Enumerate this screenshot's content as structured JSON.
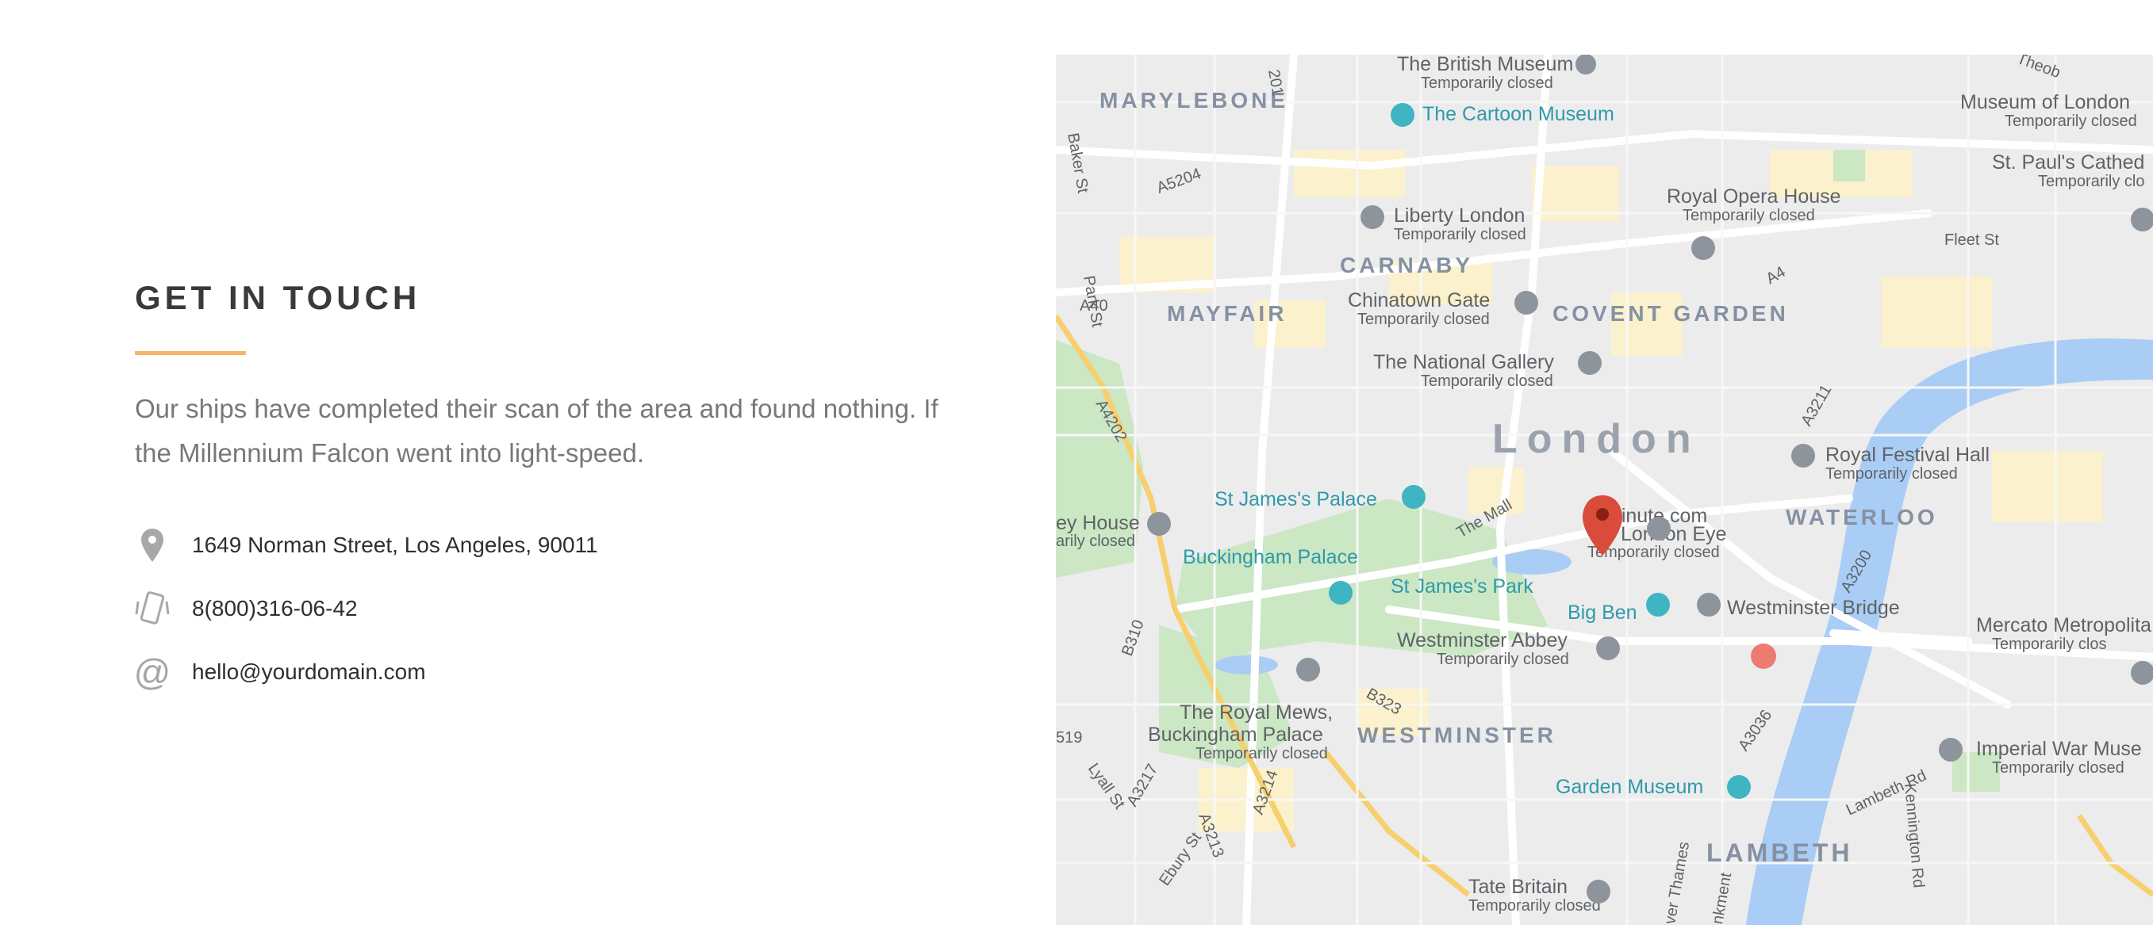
{
  "contact": {
    "heading": "GET IN TOUCH",
    "intro": "Our ships have completed their scan of the area and found nothing. If the Millennium Falcon went into light-speed.",
    "items": [
      {
        "icon": "location-pin-icon",
        "text": "1649 Norman Street, Los Angeles, 90011"
      },
      {
        "icon": "phone-icon",
        "text": "8(800)316-06-42"
      },
      {
        "icon": "at-sign-icon",
        "text": "hello@yourdomain.com"
      }
    ],
    "accent_color": "#f5b66b"
  },
  "map": {
    "city": "London",
    "districts": [
      "MARYLEBONE",
      "CARNABY",
      "MAYFAIR",
      "COVENT GARDEN",
      "WATERLOO",
      "WESTMINSTER",
      "LAMBETH"
    ],
    "pois": [
      {
        "name": "The British Museum",
        "note": "Temporarily closed"
      },
      {
        "name": "The Cartoon Museum"
      },
      {
        "name": "Museum of London",
        "note": "Temporarily closed"
      },
      {
        "name": "St. Paul's Cathed",
        "note": "Temporarily clo"
      },
      {
        "name": "Royal Opera House",
        "note": "Temporarily closed"
      },
      {
        "name": "Liberty London",
        "note": "Temporarily closed"
      },
      {
        "name": "Chinatown Gate",
        "note": "Temporarily closed"
      },
      {
        "name": "The National Gallery",
        "note": "Temporarily closed"
      },
      {
        "name": "Royal Festival Hall",
        "note": "Temporarily closed"
      },
      {
        "name": "St James's Palace"
      },
      {
        "name": "Buckingham Palace"
      },
      {
        "name": "St James's Park"
      },
      {
        "name": "minute.com"
      },
      {
        "name": "London Eye",
        "note": "Temporarily closed"
      },
      {
        "name": "Big Ben"
      },
      {
        "name": "Westminster Bridge"
      },
      {
        "name": "Westminster Abbey",
        "note": "Temporarily closed"
      },
      {
        "name": "Mercato Metropolita",
        "note": "Temporarily clos"
      },
      {
        "name": "The Royal Mews,"
      },
      {
        "name": "Buckingham Palace",
        "note": "Temporarily closed"
      },
      {
        "name": "Imperial War Muse",
        "note": "Temporarily closed"
      },
      {
        "name": "Garden Museum"
      },
      {
        "name": "Tate Britain",
        "note": "Temporarily closed"
      },
      {
        "name": "ey House",
        "note": "arily closed"
      }
    ],
    "roads": [
      "A40",
      "A5204",
      "A4",
      "A4202",
      "A3211",
      "A3200",
      "B310",
      "B323",
      "A3217",
      "A3213",
      "A3214",
      "A3036",
      "Baker St",
      "Park St",
      "Fleet St",
      "The Mall",
      "Lambeth Rd",
      "Kennington Rd",
      "Lyall St",
      "Ebury St",
      "ver Thames",
      "nkment",
      "201",
      "519",
      "Theob"
    ]
  }
}
